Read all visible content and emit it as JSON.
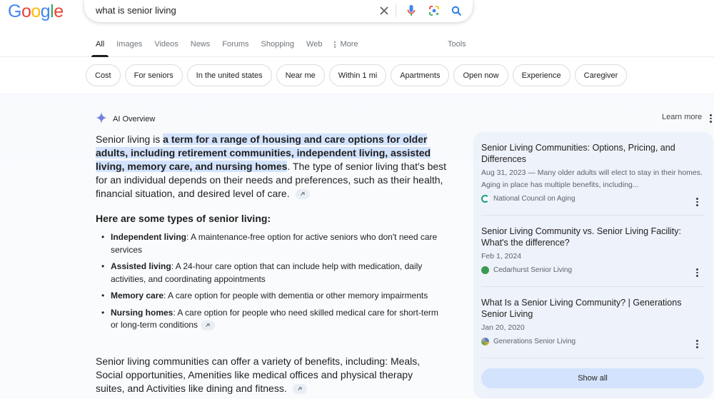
{
  "header": {
    "logo_letters": [
      {
        "ch": "G",
        "color": "#4285F4"
      },
      {
        "ch": "o",
        "color": "#EA4335"
      },
      {
        "ch": "o",
        "color": "#FBBC05"
      },
      {
        "ch": "g",
        "color": "#4285F4"
      },
      {
        "ch": "l",
        "color": "#34A853"
      },
      {
        "ch": "e",
        "color": "#EA4335"
      }
    ],
    "search": {
      "query": "what is senior living",
      "icons": [
        "close-icon",
        "microphone-icon",
        "lens-icon",
        "search-icon"
      ]
    },
    "tabs": [
      {
        "label": "All",
        "active": true
      },
      {
        "label": "Images"
      },
      {
        "label": "Videos"
      },
      {
        "label": "News"
      },
      {
        "label": "Forums"
      },
      {
        "label": "Shopping"
      },
      {
        "label": "Web"
      },
      {
        "label": "More",
        "icon": "kebab-icon"
      }
    ],
    "tools_label": "Tools"
  },
  "chips": [
    "Cost",
    "For seniors",
    "In the united states",
    "Near me",
    "Within 1 mi",
    "Apartments",
    "Open now",
    "Experience",
    "Caregiver"
  ],
  "ai_overview": {
    "title": "AI Overview",
    "learn_more": "Learn more",
    "intro": {
      "prefix": "Senior living is ",
      "highlight": "a term for a range of housing and care options for older adults, including retirement communities, independent living, assisted living, memory care, and nursing homes",
      "suffix": ". The type of senior living that's best for an individual depends on their needs and preferences, such as their health, financial situation, and desired level of care."
    },
    "types_heading": "Here are some types of senior living:",
    "types": [
      {
        "term": "Independent living",
        "desc": ": A maintenance-free option for active seniors who don't need care services"
      },
      {
        "term": "Assisted living",
        "desc": ": A 24-hour care option that can include help with medication, daily activities, and coordinating appointments"
      },
      {
        "term": "Memory care",
        "desc": ": A care option for people with dementia or other memory impairments"
      },
      {
        "term": "Nursing homes",
        "desc": ": A care option for people who need skilled medical care for short-term or long-term conditions"
      }
    ],
    "benefits": "Senior living communities can offer a variety of benefits, including: Meals, Social opportunities, Amenities like medical offices and physical therapy suites, and Activities like dining and fitness."
  },
  "sources": {
    "items": [
      {
        "title": "Senior Living Communities: Options, Pricing, and Differences",
        "snippet": "Aug 31, 2023 — Many older adults will elect to stay in their homes. Aging in place has multiple benefits, including...",
        "site": "National Council on Aging",
        "favicon_color": "#1a9e7a"
      },
      {
        "title": "Senior Living Community vs. Senior Living Facility: What's the difference?",
        "snippet": "Feb 1, 2024",
        "site": "Cedarhurst Senior Living",
        "favicon_color": "#3a9a4e"
      },
      {
        "title": "What Is a Senior Living Community? | Generations Senior Living",
        "snippet": "Jan 20, 2020",
        "site": "Generations Senior Living",
        "favicon_color": "#c9a23a"
      }
    ],
    "show_all": "Show all"
  }
}
